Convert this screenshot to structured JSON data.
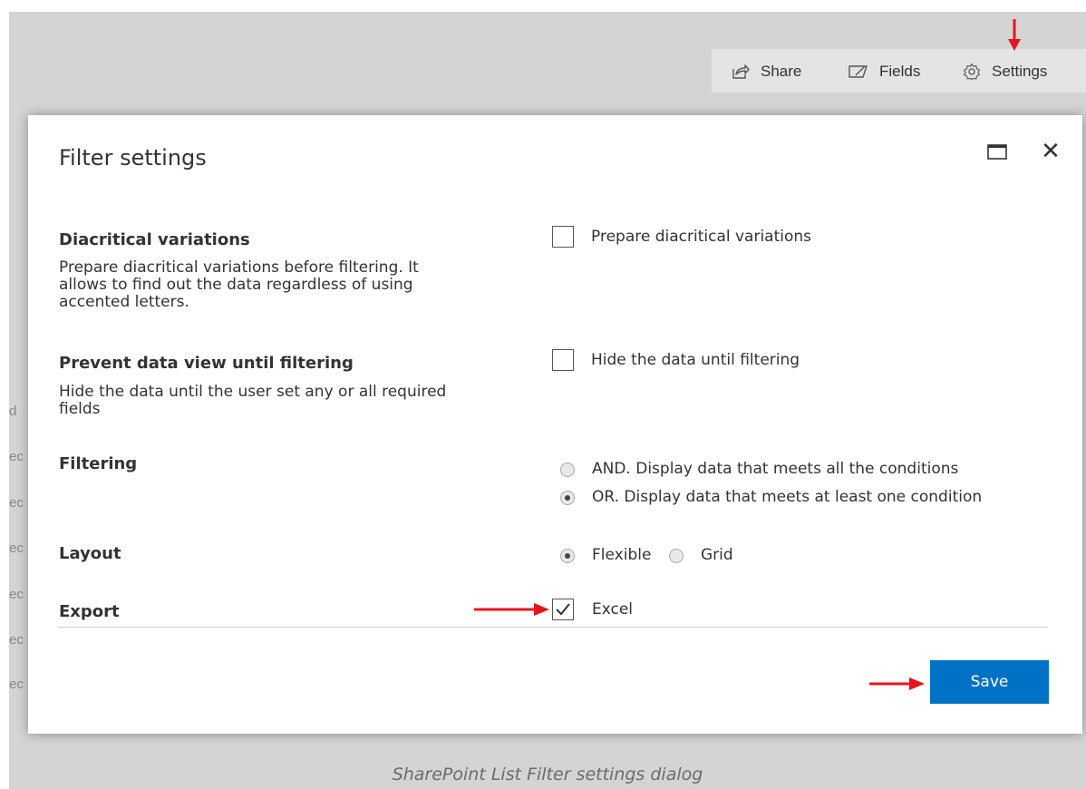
{
  "toolbar": {
    "share_label": "Share",
    "fields_label": "Fields",
    "settings_label": "Settings"
  },
  "background_fragments": [
    "d",
    "ec",
    "ec",
    "ec",
    "ec",
    "ec",
    "ec"
  ],
  "dialog": {
    "title": "Filter settings",
    "options": {
      "diacritical": {
        "title": "Diacritical variations",
        "desc_lines": [
          "Prepare diacritical variations before filtering. It",
          "allows to find out the data regardless of using",
          "accented letters."
        ],
        "checkbox_label": "Prepare diacritical variations",
        "checked": false
      },
      "prevent": {
        "title": "Prevent data view until filtering",
        "desc_lines": [
          "Hide the data until the user set any or all required",
          "fields"
        ],
        "checkbox_label": "Hide the data until filtering",
        "checked": false
      },
      "filtering": {
        "title": "Filtering",
        "and_label": "AND. Display data that meets all the conditions",
        "or_label": "OR. Display data that meets at least one condition",
        "selected": "OR"
      },
      "layout": {
        "title": "Layout",
        "flexible_label": "Flexible",
        "grid_label": "Grid",
        "selected": "Flexible"
      },
      "export": {
        "title": "Export",
        "excel_label": "Excel",
        "checked": true
      }
    },
    "save_label": "Save"
  },
  "caption": "SharePoint List Filter settings dialog",
  "colors": {
    "accent": "#0072c6",
    "annotation_arrow": "#e8141c",
    "backdrop": "#d4d4d4"
  }
}
